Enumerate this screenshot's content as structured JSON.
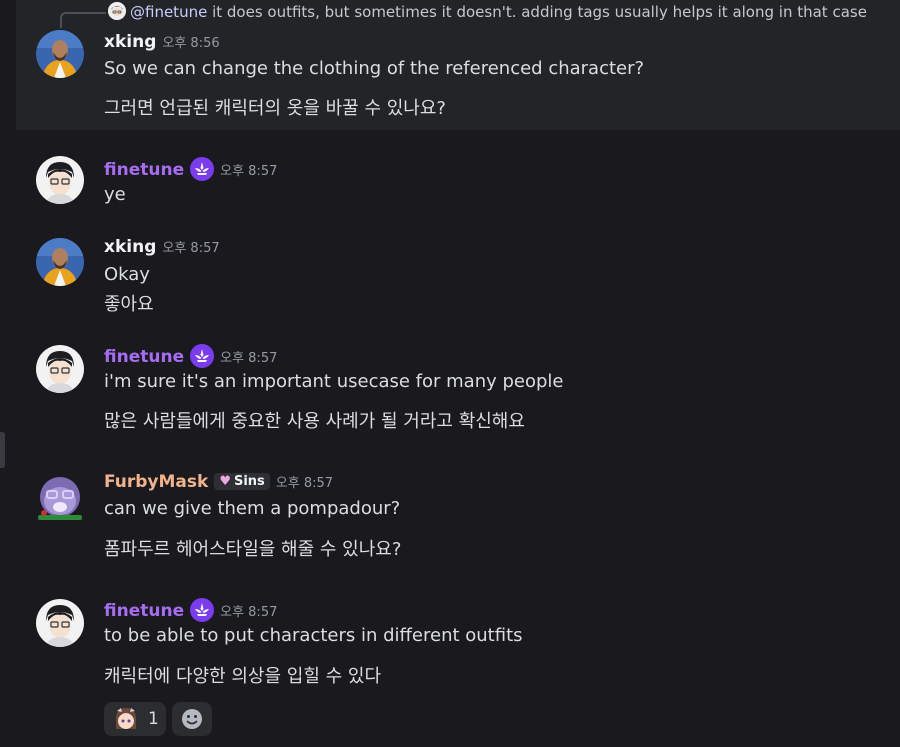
{
  "colors": {
    "xking": "#f2f3f5",
    "finetune": "#a66cf2",
    "furbymask": "#f0b48c"
  },
  "reply": {
    "mention": "@finetune",
    "text": " it does outfits, but sometimes it doesn't. adding tags usually helps it along in that case"
  },
  "messages": [
    {
      "user": "xking",
      "time": "오후 8:56",
      "lines": [
        "So we can change the clothing  of the referenced character?",
        "그러면 언급된 캐릭터의 옷을 바꿀 수 있나요?"
      ]
    },
    {
      "user": "finetune",
      "time": "오후 8:57",
      "badge": "verified-flower-icon",
      "lines": [
        "ye"
      ]
    },
    {
      "user": "xking",
      "time": "오후 8:57",
      "lines": [
        "Okay",
        "좋아요"
      ]
    },
    {
      "user": "finetune",
      "time": "오후 8:57",
      "badge": "verified-flower-icon",
      "lines": [
        "i'm sure it's an important usecase for many people",
        "많은 사람들에게 중요한 사용 사례가 될 거라고 확신해요"
      ]
    },
    {
      "user": "FurbyMask",
      "time": "오후 8:57",
      "tag": "Sins",
      "lines": [
        "can we give them a pompadour?",
        "폼파두르 헤어스타일을 해줄 수 있나요?"
      ]
    },
    {
      "user": "finetune",
      "time": "오후 8:57",
      "badge": "verified-flower-icon",
      "lines": [
        "to be able to put characters in different outfits",
        "캐릭터에 다양한 의상을 입힐 수 있다"
      ]
    }
  ],
  "reactions": [
    {
      "icon": "character-emoji-icon",
      "count": "1"
    },
    {
      "icon": "add-reaction-icon"
    }
  ]
}
